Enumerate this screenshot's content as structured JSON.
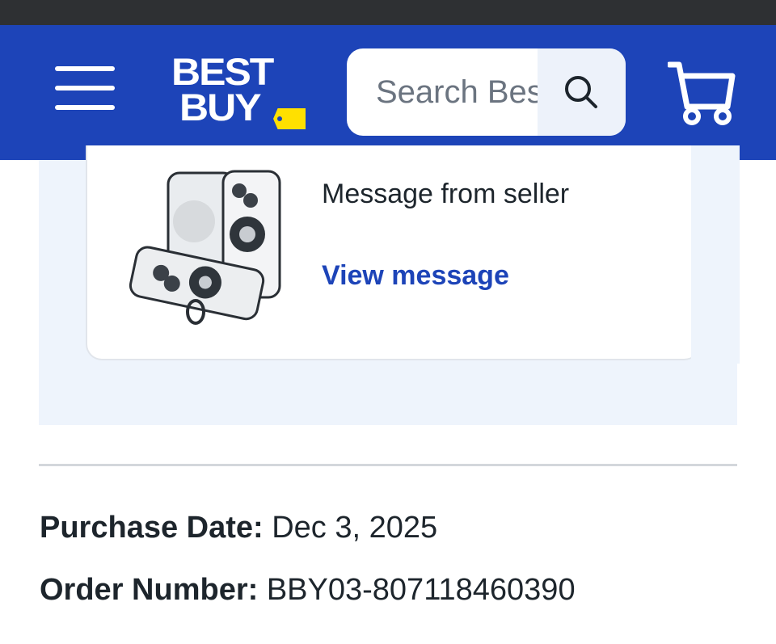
{
  "header": {
    "menu_icon": "hamburger-menu-icon",
    "logo": {
      "line1": "BEST",
      "line2": "BUY",
      "tag_color": "#ffe000"
    },
    "search": {
      "placeholder": "Search Best Buy",
      "value": "",
      "icon": "search-icon"
    },
    "cart_icon": "shopping-cart-icon",
    "brand_color": "#1d44b8"
  },
  "seller_card": {
    "image_icon": "phone-case-product-image",
    "message_title": "Message from seller",
    "view_link": "View message"
  },
  "order": {
    "purchase_date_label": "Purchase Date:",
    "purchase_date_value": "Dec 3, 2025",
    "order_number_label": "Order Number:",
    "order_number_value": "BBY03-807118460390"
  }
}
